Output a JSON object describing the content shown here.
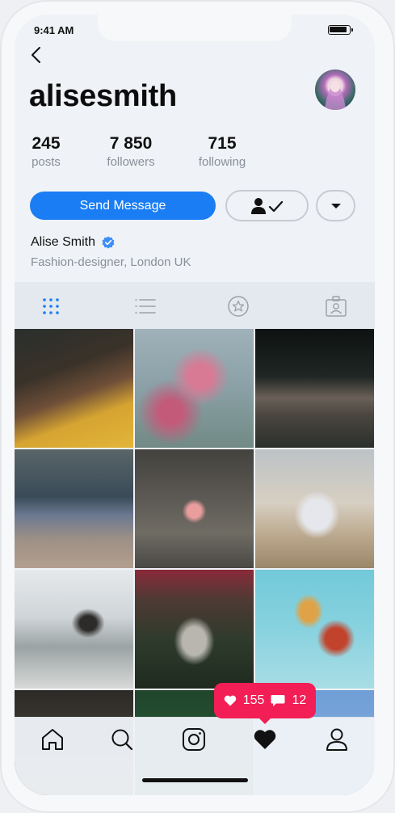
{
  "status": {
    "time": "9:41 AM"
  },
  "profile": {
    "username": "alisesmith",
    "full_name": "Alise Smith",
    "bio": "Fashion-designer, London UK"
  },
  "stats": [
    {
      "value": "245",
      "label": "posts"
    },
    {
      "value": "7 850",
      "label": "followers"
    },
    {
      "value": "715",
      "label": "following"
    }
  ],
  "actions": {
    "send_message": "Send Message"
  },
  "tabs": [
    "grid-icon",
    "list-icon",
    "star-icon",
    "tagged-icon"
  ],
  "colors": {
    "accent": "#1a7df4",
    "notification": "#f21e55",
    "verified": "#3e8ef7"
  },
  "notification": {
    "likes": "155",
    "comments": "12"
  },
  "tabbar": [
    "home-icon",
    "search-icon",
    "camera-icon",
    "heart-icon",
    "profile-icon"
  ]
}
